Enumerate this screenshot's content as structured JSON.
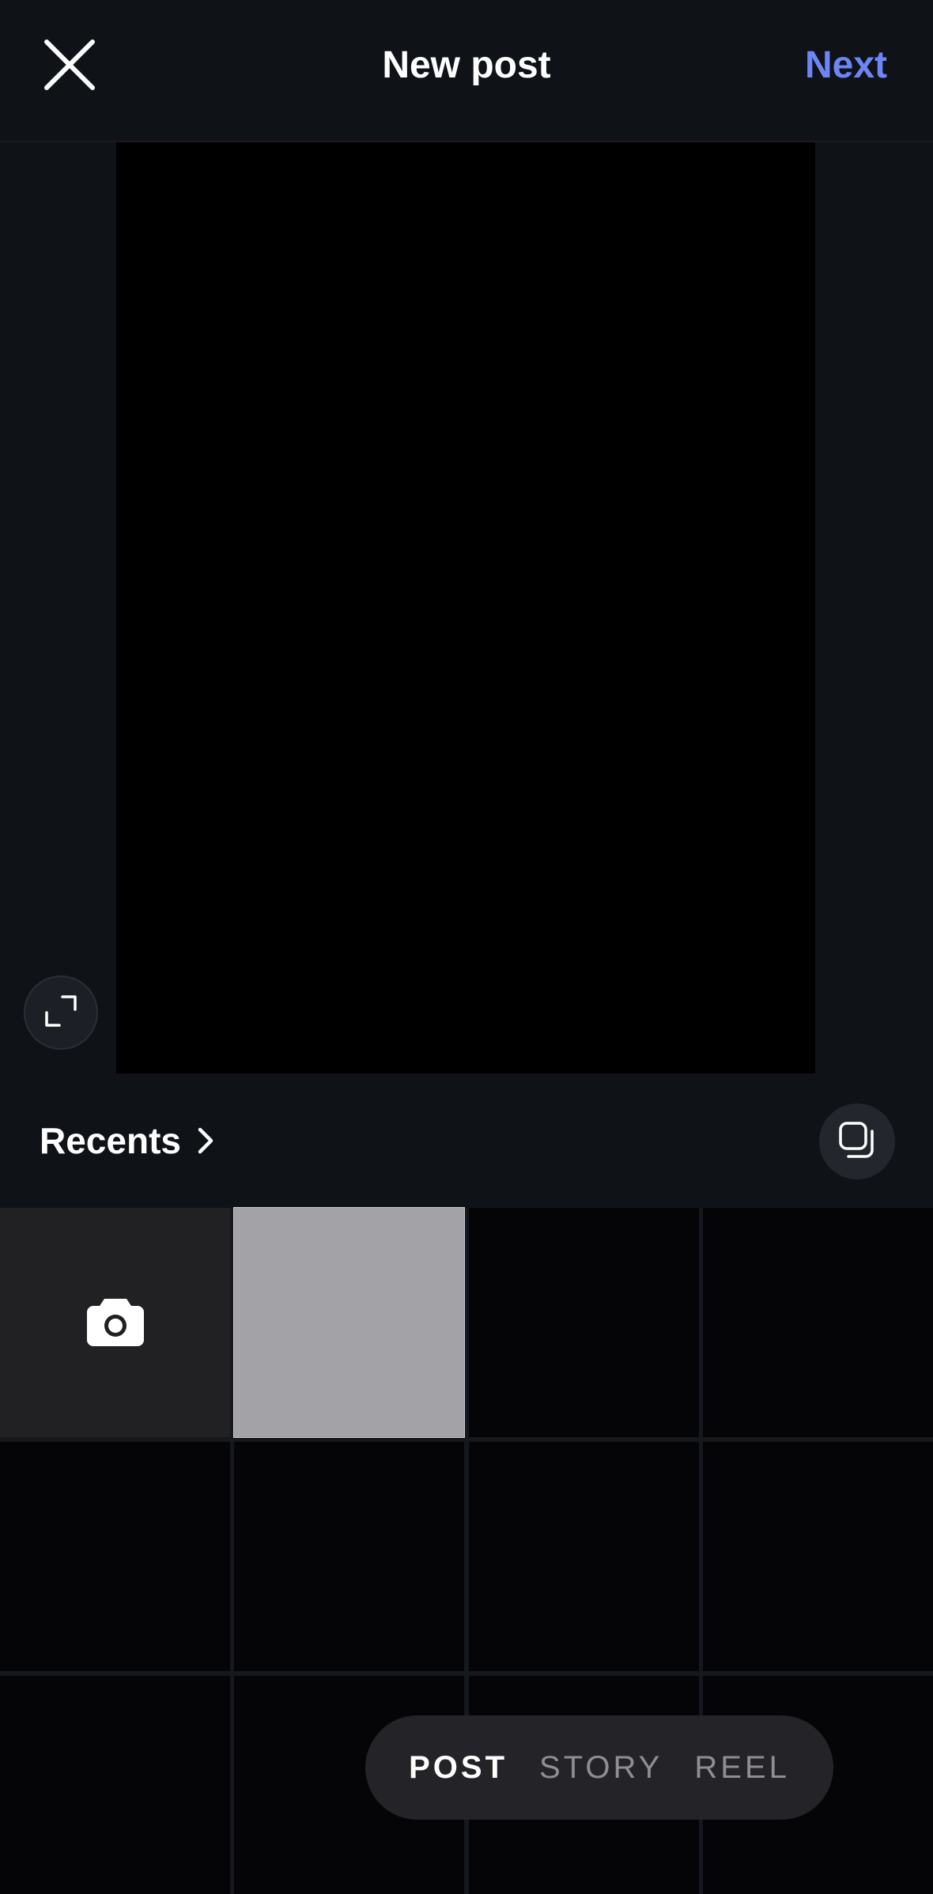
{
  "header": {
    "title": "New post",
    "next_label": "Next",
    "close_icon": "close-icon"
  },
  "preview": {
    "expand_icon": "expand-icon"
  },
  "recents": {
    "label": "Recents",
    "chevron_icon": "chevron-right-icon",
    "multi_select_icon": "multi-select-icon"
  },
  "grid": {
    "camera_icon": "camera-icon"
  },
  "modes": {
    "items": [
      "POST",
      "STORY",
      "REEL"
    ],
    "active": "POST"
  },
  "colors": {
    "background": "#0f1318",
    "accent": "#6e86f5",
    "text": "#ffffff",
    "inactive_mode": "#8e8e93"
  }
}
